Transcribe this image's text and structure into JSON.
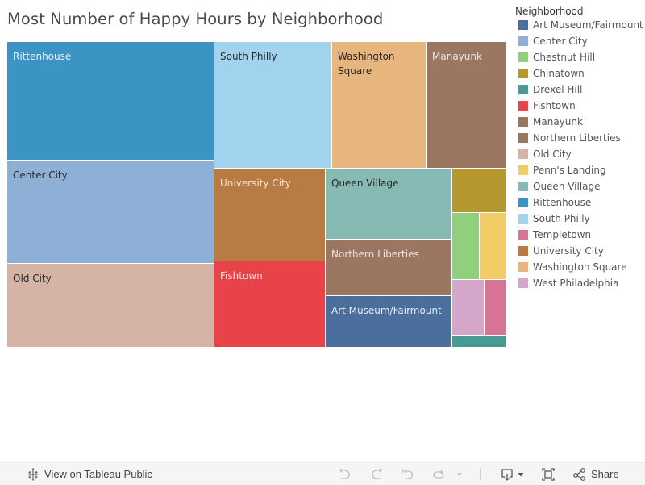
{
  "chart_data": {
    "type": "treemap",
    "title": "Most Number of Happy Hours by Neighborhood",
    "size_measure_note": "Cell sizes are estimated relative counts; no values printed on chart",
    "legend": {
      "title": "Neighborhood",
      "placement": "right",
      "items": [
        {
          "name": "Art Museum/Fairmount",
          "color": "#4a6f9c"
        },
        {
          "name": "Center City",
          "color": "#8fb0d6"
        },
        {
          "name": "Chestnut Hill",
          "color": "#8ed07b"
        },
        {
          "name": "Chinatown",
          "color": "#b5972f"
        },
        {
          "name": "Drexel Hill",
          "color": "#4a9a94"
        },
        {
          "name": "Fishtown",
          "color": "#e84349"
        },
        {
          "name": "Manayunk",
          "color": "#9b7660"
        },
        {
          "name": "Northern Liberties",
          "color": "#9b7660"
        },
        {
          "name": "Old City",
          "color": "#d5b4a5"
        },
        {
          "name": "Penn's Landing",
          "color": "#f0cd67"
        },
        {
          "name": "Queen Village",
          "color": "#85bbb4"
        },
        {
          "name": "Rittenhouse",
          "color": "#3b94c4"
        },
        {
          "name": "South Philly",
          "color": "#a1d3ef"
        },
        {
          "name": "Templetown",
          "color": "#d57495"
        },
        {
          "name": "University City",
          "color": "#b87b43"
        },
        {
          "name": "Washington Square",
          "color": "#e7b57e"
        },
        {
          "name": "West Philadelphia",
          "color": "#d4a6c9"
        }
      ]
    },
    "cells": [
      {
        "name": "Rittenhouse",
        "value": 41,
        "label": "Rittenhouse",
        "color": "#3b94c4",
        "label_color": "#e8f2f9"
      },
      {
        "name": "Center City",
        "value": 36,
        "label": "Center City",
        "color": "#8fb0d6",
        "label_color": "#2a2a2a"
      },
      {
        "name": "Old City",
        "value": 29,
        "label": "Old City",
        "color": "#d5b4a5",
        "label_color": "#2a2a2a"
      },
      {
        "name": "South Philly",
        "value": 25,
        "label": "South Philly",
        "color": "#a1d3ef",
        "label_color": "#2a2a2a"
      },
      {
        "name": "Washington Square",
        "value": 20,
        "label": "Washington Square",
        "color": "#e7b57e",
        "label_color": "#2a2a2a"
      },
      {
        "name": "Manayunk",
        "value": 17,
        "label": "Manayunk",
        "color": "#9b7660",
        "label_color": "#f0e6e0"
      },
      {
        "name": "University City",
        "value": 17,
        "label": "University City",
        "color": "#b87b43",
        "label_color": "#f3e6d8"
      },
      {
        "name": "Fishtown",
        "value": 16,
        "label": "Fishtown",
        "color": "#e84349",
        "label_color": "#fbe0e1"
      },
      {
        "name": "Queen Village",
        "value": 15,
        "label": "Queen Village",
        "color": "#85bbb4",
        "label_color": "#2a2a2a"
      },
      {
        "name": "Northern Liberties",
        "value": 12,
        "label": "Northern Liberties",
        "color": "#9b7660",
        "label_color": "#f0e6e0"
      },
      {
        "name": "Art Museum/Fairmount",
        "value": 11,
        "label": "Art Museum/Fairmount",
        "color": "#4a6f9c",
        "label_color": "#e6edf5"
      },
      {
        "name": "Chinatown",
        "value": 4,
        "label": "",
        "color": "#b5972f",
        "label_color": "#2a2a2a"
      },
      {
        "name": "Chestnut Hill",
        "value": 3,
        "label": "",
        "color": "#8ed07b",
        "label_color": "#2a2a2a"
      },
      {
        "name": "Penn's Landing",
        "value": 3,
        "label": "",
        "color": "#f0cd67",
        "label_color": "#2a2a2a"
      },
      {
        "name": "West Philadelphia",
        "value": 3,
        "label": "",
        "color": "#d4a6c9",
        "label_color": "#2a2a2a"
      },
      {
        "name": "Templetown",
        "value": 2,
        "label": "",
        "color": "#d57495",
        "label_color": "#2a2a2a"
      },
      {
        "name": "Drexel Hill",
        "value": 1,
        "label": "",
        "color": "#4a9a94",
        "label_color": "#2a2a2a"
      }
    ]
  },
  "toolbar": {
    "view_on_tableau_label": "View on Tableau Public",
    "share_label": "Share",
    "icons": [
      "tableau-logo-icon",
      "undo-icon",
      "redo-icon",
      "revert-icon",
      "refresh-icon",
      "dropdown-caret-icon",
      "download-icon",
      "fullscreen-icon",
      "share-icon"
    ]
  }
}
